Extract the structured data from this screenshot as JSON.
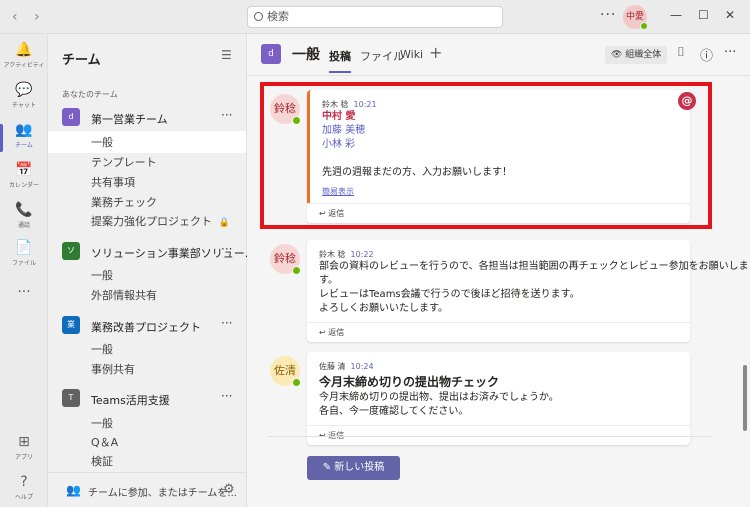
{
  "search": {
    "placeholder": "検索"
  },
  "user": {
    "initials": "中愛"
  },
  "rail": [
    {
      "icon": "🔔",
      "label": "アクティビティ"
    },
    {
      "icon": "💬",
      "label": "チャット"
    },
    {
      "icon": "👥",
      "label": "チーム"
    },
    {
      "icon": "📅",
      "label": "カレンダー"
    },
    {
      "icon": "📞",
      "label": "通話"
    },
    {
      "icon": "📄",
      "label": "ファイル"
    },
    {
      "icon": "···",
      "label": ""
    },
    {
      "icon": "⊞",
      "label": "アプリ"
    },
    {
      "icon": "?",
      "label": "ヘルプ"
    }
  ],
  "teams_panel": {
    "title": "チーム",
    "section": "あなたのチーム",
    "teams": [
      {
        "initial": "d",
        "color": "#7b5fc7",
        "name": "第一営業チーム",
        "channels": [
          "一般",
          "テンプレート",
          "共有事項",
          "業務チェック",
          "提案力強化プロジェクト"
        ]
      },
      {
        "initial": "ソ",
        "color": "#2e7d32",
        "name": "ソリューション事業部ソリュー...",
        "channels": [
          "一般",
          "外部情報共有"
        ]
      },
      {
        "initial": "業",
        "color": "#0f6cbd",
        "name": "業務改善プロジェクト",
        "channels": [
          "一般",
          "事例共有"
        ]
      },
      {
        "initial": "T",
        "color": "#616161",
        "name": "Teams活用支援",
        "channels": [
          "一般",
          "Q＆A",
          "検証"
        ]
      }
    ],
    "footer": "チームに参加、またはチームを..."
  },
  "channel": {
    "icon": "d",
    "name": "一般",
    "tabs": [
      "投稿",
      "ファイル",
      "Wiki"
    ],
    "org_button": "組織全体"
  },
  "messages": [
    {
      "avatar": "鈴稔",
      "author": "鈴木 稔",
      "time": "10:21",
      "mentions": [
        "中村 愛",
        "加藤 美穂",
        "小林 彩"
      ],
      "text": "先週の週報まだの方、入力お願いします！",
      "collapse": "簡易表示",
      "reply": "返信"
    },
    {
      "avatar": "鈴稔",
      "author": "鈴木 稔",
      "time": "10:22",
      "lines": [
        "部会の資料のレビューを行うので、各担当は担当範囲の再チェックとレビュー参加をお願いしま",
        "す。",
        "レビューはTeams会議で行うので後ほど招待を送ります。",
        "よろしくお願いいたします。"
      ],
      "reply": "返信"
    },
    {
      "avatar": "佐清",
      "author": "佐藤 清",
      "time": "10:24",
      "subject": "今月末締め切りの提出物チェック",
      "lines": [
        "今月末締め切りの提出物、提出はお済みでしょうか。",
        "各自、今一度確認してください。"
      ],
      "reply": "返信"
    }
  ],
  "new_post": "新しい投稿"
}
